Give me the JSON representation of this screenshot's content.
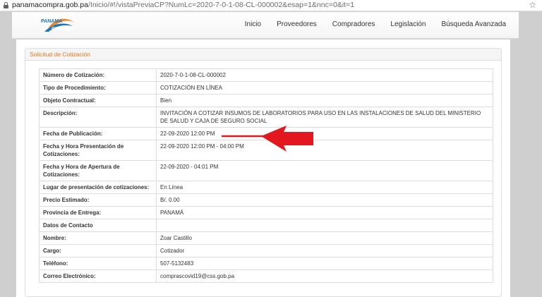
{
  "browser": {
    "url_domain": "panamacompra.gob.pa",
    "url_path": "/Inicio/#!/vistaPreviaCP?NumLc=2020-7-0-1-08-CL-000002&esap=1&nnc=0&it=1"
  },
  "logo": {
    "line1": "PANAMA",
    "line2": "COMPRA"
  },
  "nav": {
    "items": [
      "Inicio",
      "Proveedores",
      "Compradores",
      "Legislación",
      "Búsqueda Avanzada"
    ]
  },
  "panel": {
    "title": "Solicitud de Cotización"
  },
  "rows": [
    {
      "label": "Número de Cotización:",
      "value": "2020-7-0-1-08-CL-000002"
    },
    {
      "label": "Tipo de Procedimiento:",
      "value": "COTIZACIÓN EN LÍNEA"
    },
    {
      "label": "Objeto Contractual:",
      "value": "Bien"
    },
    {
      "label": "Descripción:",
      "value": "INVITACIÓN A COTIZAR INSUMOS DE LABORATORIOS PARA USO EN LAS INSTALACIONES DE SALUD DEL MINISTERIO DE SALUD Y CAJA DE SEGURO SOCIAL"
    },
    {
      "label": "Fecha de Publicación:",
      "value": "22-09-2020 12:00 PM"
    },
    {
      "label": "Fecha y Hora Presentación de Cotizaciones:",
      "value": "22-09-2020 12:00 PM - 04:00 PM"
    },
    {
      "label": "Fecha y Hora de Apertura de Cotizaciones:",
      "value": "22-09-2020 - 04:01 PM"
    },
    {
      "label": "Lugar de presentación de cotizaciones:",
      "value": "En Línea"
    },
    {
      "label": "Precio Estimado:",
      "value": "B/. 0.00"
    },
    {
      "label": "Provincia de Entrega:",
      "value": "PANAMÁ"
    },
    {
      "label": "Datos de Contacto",
      "value": ""
    },
    {
      "label": "Nombre:",
      "value": "Zoar Castillo"
    },
    {
      "label": "Cargo:",
      "value": "Cotizador"
    },
    {
      "label": "Teléfono:",
      "value": "507-5132483"
    },
    {
      "label": "Correo Electrónico:",
      "value": "comprascovid19@css.gob.pa"
    }
  ],
  "colors": {
    "accent": "#e8731c",
    "arrow": "#e3171f"
  }
}
